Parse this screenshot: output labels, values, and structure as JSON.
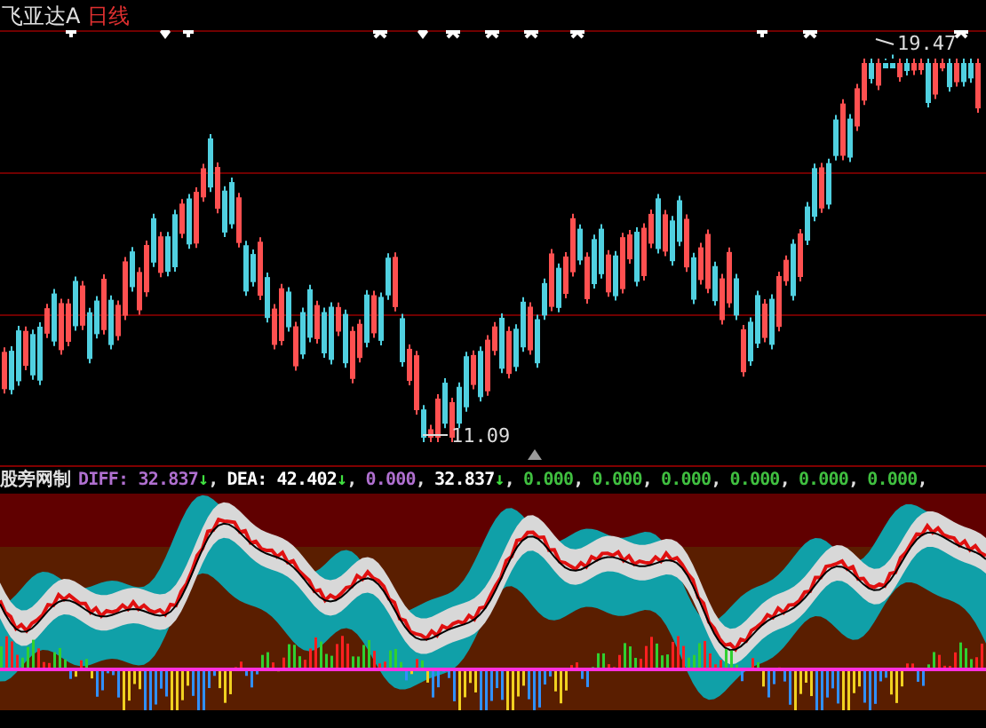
{
  "header": {
    "stock_name": "飞亚达A",
    "period": "日线"
  },
  "price_chart": {
    "high_label": "19.47",
    "low_label": "11.09"
  },
  "indicator": {
    "name": "股旁网制",
    "legend": [
      {
        "kind": "diff",
        "label": "DIFF:",
        "value": "32.837",
        "arrow": "↓",
        "separator": ","
      },
      {
        "kind": "dea",
        "label": "DEA:",
        "value": "42.402",
        "arrow": "↓",
        "separator": ","
      },
      {
        "kind": "diff",
        "value": "0.000",
        "separator": ","
      },
      {
        "kind": "dea",
        "value": "32.837",
        "arrow": "↓",
        "separator": ","
      },
      {
        "kind": "other",
        "value": "0.000",
        "separator": ","
      },
      {
        "kind": "other",
        "value": "0.000",
        "separator": ","
      },
      {
        "kind": "other",
        "value": "0.000",
        "separator": ","
      },
      {
        "kind": "other",
        "value": "0.000",
        "separator": ","
      },
      {
        "kind": "other",
        "value": "0.000",
        "separator": ","
      },
      {
        "kind": "other",
        "value": "0.000",
        "separator": ","
      }
    ]
  }
}
